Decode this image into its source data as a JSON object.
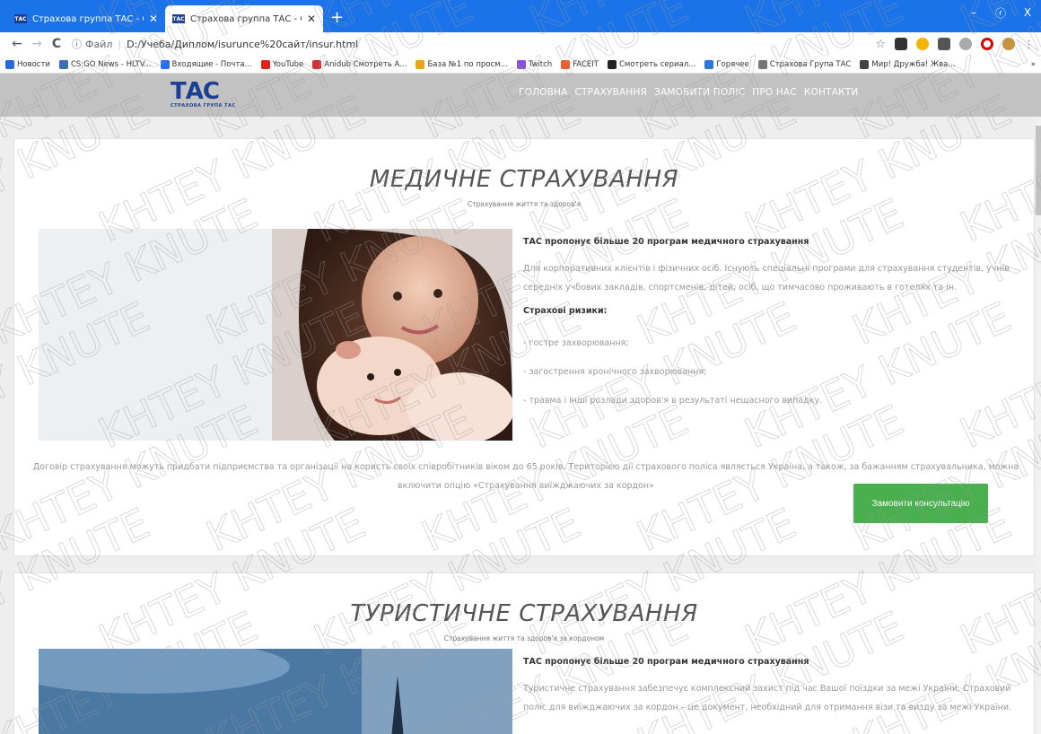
{
  "browser": {
    "tabs": [
      {
        "title": "Страхова группа ТАС - СГ ТАС",
        "favicon": "ТАС",
        "active": false
      },
      {
        "title": "Страхова группа ТАС - СГ ТАС",
        "favicon": "ТАС",
        "active": true
      }
    ],
    "new_tab": "+",
    "window_controls": {
      "minimize": "–",
      "maximize": "ⓡ",
      "close": "X"
    },
    "nav": {
      "back": "←",
      "forward": "→",
      "reload": "C"
    },
    "url": {
      "info": "ⓘ",
      "scheme": "Файл",
      "sep": "|",
      "path": "D:/Учеба/Диплом/isurunce%20сайт/insur.html"
    },
    "bookmarks": [
      {
        "label": "Новости",
        "color": "#2a6ad8"
      },
      {
        "label": "CS:GO News - HLTV...",
        "color": "#3a6fb0"
      },
      {
        "label": "Входящие - Почта...",
        "color": "#2b6de8"
      },
      {
        "label": "YouTube",
        "color": "#e62117"
      },
      {
        "label": "Anidub Смотреть А...",
        "color": "#c33"
      },
      {
        "label": "База №1 по просм...",
        "color": "#e6a22a"
      },
      {
        "label": "Twitch",
        "color": "#8a4de0"
      },
      {
        "label": "FACEIT",
        "color": "#f05a28"
      },
      {
        "label": "Смотреть сериал...",
        "color": "#222"
      },
      {
        "label": "Горячее",
        "color": "#2b78d8"
      },
      {
        "label": "Страхова Група ТАС",
        "color": "#777"
      },
      {
        "label": "Мир! Дружба! Жва...",
        "color": "#444"
      }
    ],
    "bookmarks_more": "»"
  },
  "header": {
    "logo_big": "ТАС",
    "logo_small": "СТРАХОВА ГРУПА ТАС",
    "nav": [
      "ГОЛОВНА",
      "СТРАХУВАННЯ",
      "ЗАМОВИТИ ПОЛІС",
      "ПРО НАС",
      "КОНТАКТИ"
    ],
    "colors": {
      "bar": "#c2c2c2",
      "logo": "#1b3f94"
    }
  },
  "section_medical": {
    "title": "МЕДИЧНЕ СТРАХУВАННЯ",
    "subtitle": "Страхування життя та здоров'я",
    "lead": "ТАС пропонує більше 20 програм медичного страхування",
    "para": "Для корпоративних клієнтів і фізичних осіб. Існують спеціальні програми для страхування студентів, учнів середніх учбових закладів, спортсменів, дітей, осіб, що тимчасово проживають в готелях та ін.",
    "risks_title": "Страхові ризики:",
    "risks": [
      "- гостре захворювання;",
      "- загострення хронічного захворювання;",
      "- травма і інші розлади здоров'я в результаті нещасного випадку."
    ],
    "footer": "Договір страхування можуть придбати підприємства та організації на користь своїх співробітників віком до 65 років. Територією дії страхового поліса являється Україна, а також, за бажанням страхувальника, можна включити опцію «Страхування виїжджаючих за кордон»",
    "button": "Замовити консультацію",
    "button_color": "#4aaf4f"
  },
  "section_travel": {
    "title": "ТУРИСТИЧНЕ СТРАХУВАННЯ",
    "subtitle": "Страхування життя та здоров'я за кордоном",
    "lead": "ТАС пропонує більше 20 програм медичного страхування",
    "para": "Туристичне страхування забезпечує комплексний захист під час Вашої поїздки за межі України. Страховий поліс для виїжджаючих за кордон – це документ, необхідний для отримання візи та визду за межі України."
  },
  "watermark": {
    "text": "KHTEY KNUTE"
  }
}
